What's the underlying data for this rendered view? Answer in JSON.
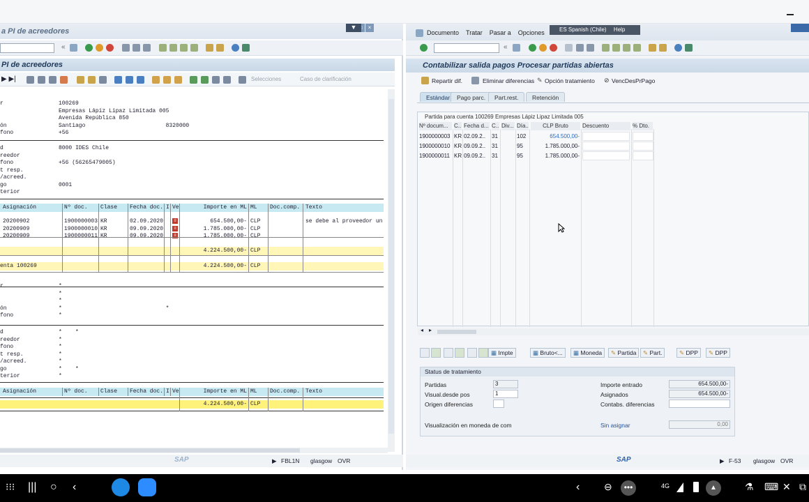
{
  "left": {
    "title": "a PI de acreedores",
    "header_title": "PI de acreedores",
    "app_toolbar": {
      "selections": "Selecciones",
      "clarification": "Caso de clarificación"
    },
    "vendor_block": [
      {
        "label": "r",
        "value": "100269"
      },
      {
        "label": "",
        "value": "Empresas Lápiz Lipaz Limitada 005"
      },
      {
        "label": "",
        "value": "Avenida República 850"
      },
      {
        "label": "ón",
        "value": "Santiago                        8320000"
      },
      {
        "label": "fono",
        "value": "+56"
      }
    ],
    "company_block": [
      {
        "label": "d",
        "value": "8000 IDES Chile"
      },
      {
        "label": "reedor",
        "value": ""
      },
      {
        "label": "fono",
        "value": "+56 (56265479005)"
      },
      {
        "label": "t resp.",
        "value": ""
      },
      {
        "label": "/acreed.",
        "value": ""
      },
      {
        "label": "go",
        "value": "0001"
      },
      {
        "label": "terior",
        "value": ""
      }
    ],
    "columns": [
      "Asignación",
      "Nº doc.",
      "Clase",
      "Fecha doc.",
      "I",
      "Ve",
      "Importe en ML",
      "ML",
      "Doc.comp.",
      "Texto"
    ],
    "rows": [
      {
        "asig": "20200902",
        "doc": "1900000003",
        "clase": "KR",
        "fecha": "02.09.2020",
        "importe": "654.500,00-",
        "ml": "CLP",
        "texto": "se debe al proveedor un"
      },
      {
        "asig": "20200909",
        "doc": "1900000010",
        "clase": "KR",
        "fecha": "09.09.2020",
        "importe": "1.785.000,00-",
        "ml": "CLP",
        "texto": ""
      },
      {
        "asig": "20200909",
        "doc": "1900000011",
        "clase": "KR",
        "fecha": "09.09.2020",
        "importe": "1.785.000,00-",
        "ml": "CLP",
        "texto": ""
      }
    ],
    "subtotal": {
      "importe": "4.224.500,00-",
      "ml": "CLP"
    },
    "account_total": {
      "label": "enta 100269",
      "importe": "4.224.500,00-",
      "ml": "CLP"
    },
    "star_block1": [
      {
        "label": "r",
        "value": "*"
      },
      {
        "label": "",
        "value": "*"
      },
      {
        "label": "",
        "value": "*"
      },
      {
        "label": "ón",
        "value": "*                               *"
      },
      {
        "label": "fono",
        "value": "*"
      }
    ],
    "star_block2": [
      {
        "label": "d",
        "value": "*    *"
      },
      {
        "label": "reedor",
        "value": "*"
      },
      {
        "label": "fono",
        "value": "*"
      },
      {
        "label": "t resp.",
        "value": "*"
      },
      {
        "label": "/acreed.",
        "value": "*"
      },
      {
        "label": "go",
        "value": "*    *"
      },
      {
        "label": "terior",
        "value": "*"
      }
    ],
    "total2": {
      "importe": "4.224.500,00-",
      "ml": "CLP"
    },
    "status": {
      "tcode": "FBL1N",
      "server": "glasgow",
      "mode": "OVR"
    }
  },
  "right": {
    "menu": [
      "Documento",
      "Tratar",
      "Pasar a",
      "Opciones"
    ],
    "lang": "ES Spanish (Chile)",
    "help": "Help",
    "title": "Contabilizar salida pagos Procesar partidas abiertas",
    "actions": [
      "Repartir dif.",
      "Eliminar diferencias",
      "Opción tratamiento",
      "VencDesPrPago"
    ],
    "tabs": [
      "Estándar",
      "Pago parc.",
      "Part.rest.",
      "Retención"
    ],
    "grid_title": "Partida para cuenta 100269 Empresas Lápiz Lipaz Limitada 005",
    "grid_cols": [
      "Nº docum...",
      "C..",
      "Fecha d...",
      "C..",
      "Div...",
      "Día...",
      "CLP Bruto",
      "Descuento",
      "% Dto."
    ],
    "grid_rows": [
      {
        "doc": "1900000003",
        "c": "KR",
        "fecha": "02.09.2..",
        "c2": "31",
        "dia": "102",
        "bruto": "654.500,00-"
      },
      {
        "doc": "1900000010",
        "c": "KR",
        "fecha": "09.09.2..",
        "c2": "31",
        "dia": "95",
        "bruto": "1.785.000,00-"
      },
      {
        "doc": "1900000011",
        "c": "KR",
        "fecha": "09.09.2..",
        "c2": "31",
        "dia": "95",
        "bruto": "1.785.000,00-"
      }
    ],
    "buttons": [
      "Impte",
      "Bruto<...",
      "Moneda",
      "Partida",
      "Part.",
      "DPP",
      "DPP"
    ],
    "status_title": "Status de tratamiento",
    "status_fields": {
      "partidas_label": "Partidas",
      "partidas": "3",
      "visual_label": "Visual.desde pos",
      "visual": "1",
      "origen_label": "Origen diferencias",
      "origen": "",
      "importe_label": "Importe entrado",
      "importe": "654.500,00-",
      "asignados_label": "Asignados",
      "asignados": "654.500,00-",
      "contabs_label": "Contabs. diferencias",
      "contabs": "",
      "visualiz_label": "Visualización en moneda de com",
      "sin_label": "Sin asignar",
      "sin": "0,00"
    },
    "statusbar": {
      "tcode": "F-53",
      "server": "glasgow",
      "mode": "OVR"
    }
  },
  "taskbar": {
    "network": "4G"
  }
}
